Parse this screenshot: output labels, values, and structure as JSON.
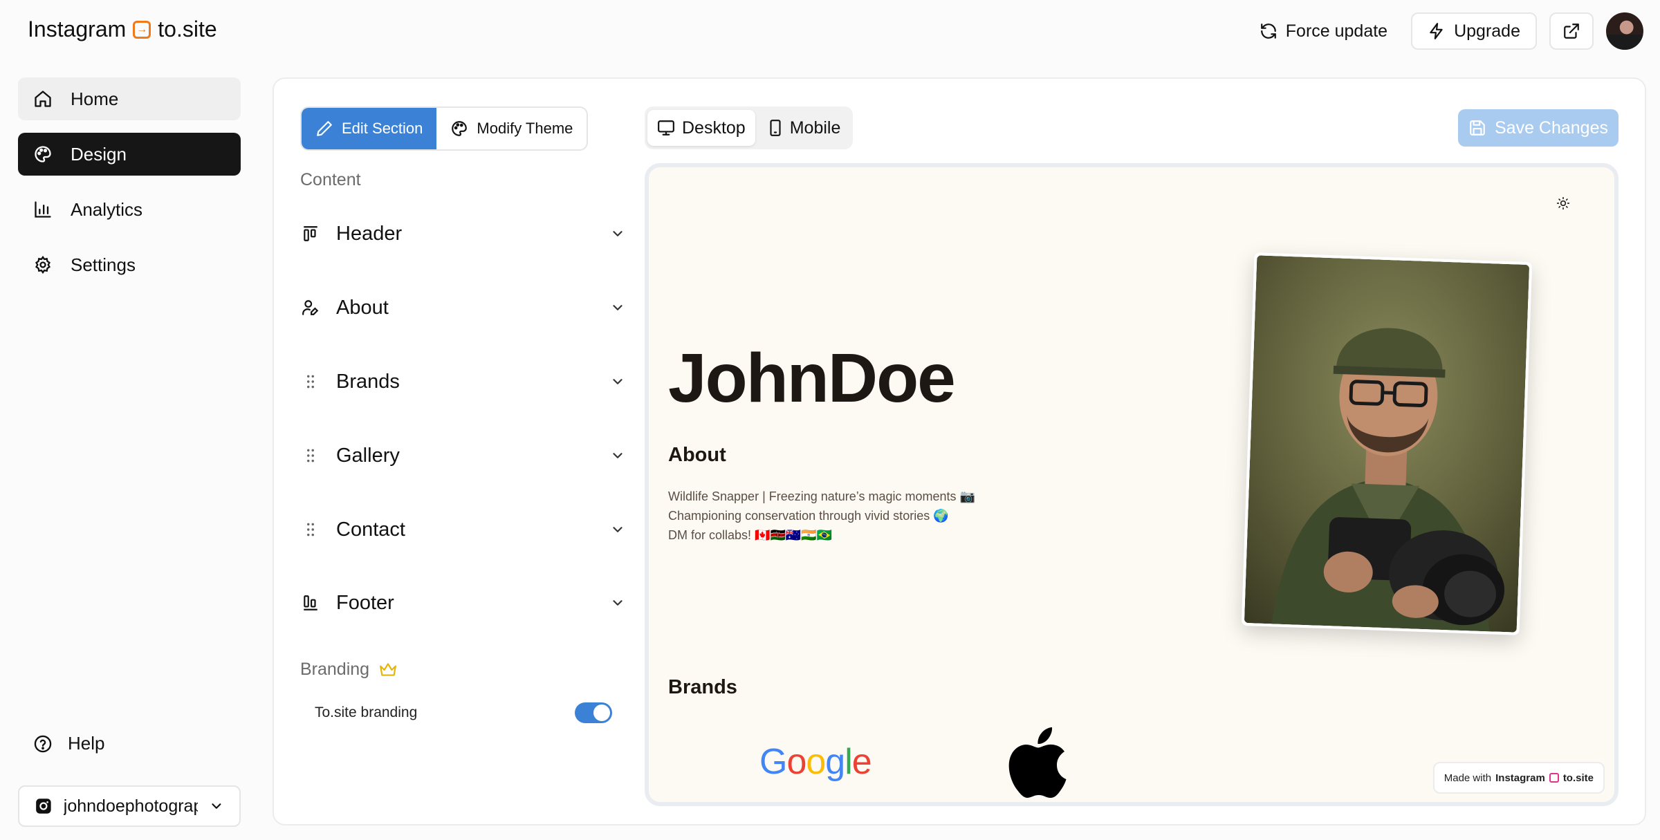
{
  "app": {
    "logo_left": "Instagram",
    "logo_right": "to.site",
    "accent": "#f07a1a"
  },
  "topbar": {
    "force_update": "Force update",
    "upgrade": "Upgrade"
  },
  "sidebar": {
    "items": [
      {
        "label": "Home",
        "icon": "home-icon"
      },
      {
        "label": "Design",
        "icon": "palette-icon"
      },
      {
        "label": "Analytics",
        "icon": "bar-chart-icon"
      },
      {
        "label": "Settings",
        "icon": "gear-icon"
      }
    ],
    "help": "Help",
    "account": "johndoephotography"
  },
  "editor": {
    "tabs": {
      "edit": "Edit Section",
      "theme": "Modify Theme"
    },
    "content_label": "Content",
    "sections": [
      {
        "label": "Header",
        "icon": "header-layout-icon"
      },
      {
        "label": "About",
        "icon": "user-edit-icon"
      },
      {
        "label": "Brands",
        "icon": "drag-handle-icon"
      },
      {
        "label": "Gallery",
        "icon": "drag-handle-icon"
      },
      {
        "label": "Contact",
        "icon": "drag-handle-icon"
      },
      {
        "label": "Footer",
        "icon": "footer-layout-icon"
      }
    ],
    "branding_label": "Branding",
    "branding_toggle_label": "To.site branding",
    "branding_toggle_on": true
  },
  "view": {
    "desktop": "Desktop",
    "mobile": "Mobile",
    "save": "Save Changes"
  },
  "preview": {
    "name": "JohnDoe",
    "about_heading": "About",
    "about_lines": [
      "Wildlife Snapper | Freezing nature’s magic moments 📷",
      "Championing conservation through vivid stories 🌍",
      "DM for collabs! 🇨🇦🇰🇪🇦🇺🇮🇳🇧🇷"
    ],
    "brands_heading": "Brands",
    "brand_google": "Google",
    "made_with": "Made with",
    "made_with_left": "Instagram",
    "made_with_right": "to.site"
  },
  "colors": {
    "primary": "#3b82d6",
    "save_disabled": "#a9cbf0",
    "preview_bg": "#fdf9f3",
    "nav_active": "#161616"
  }
}
